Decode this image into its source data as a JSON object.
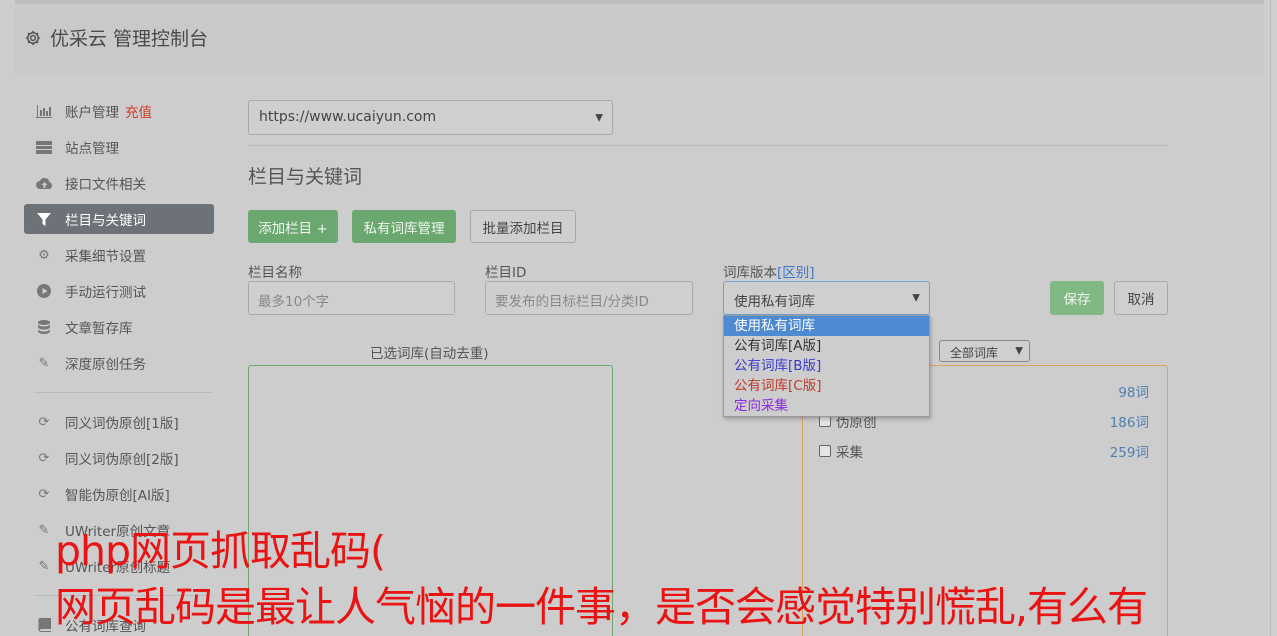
{
  "app": {
    "title": "优采云 管理控制台"
  },
  "sidebar": {
    "items": [
      {
        "label": "账户管理",
        "extra": "充值",
        "icon": "bar-chart-icon"
      },
      {
        "label": "站点管理",
        "icon": "server-icon"
      },
      {
        "label": "接口文件相关",
        "icon": "cloud-upload-icon"
      },
      {
        "label": "栏目与关键词",
        "icon": "filter-icon",
        "active": true
      },
      {
        "label": "采集细节设置",
        "icon": "cogs-icon"
      },
      {
        "label": "手动运行测试",
        "icon": "play-circle-icon"
      },
      {
        "label": "文章暂存库",
        "icon": "database-icon"
      },
      {
        "label": "深度原创任务",
        "icon": "edit-icon"
      }
    ],
    "items2": [
      {
        "label": "同义词伪原创[1版]",
        "icon": "refresh-icon"
      },
      {
        "label": "同义词伪原创[2版]",
        "icon": "refresh-icon"
      },
      {
        "label": "智能伪原创[AI版]",
        "icon": "refresh-icon"
      },
      {
        "label": "UWriter原创文章",
        "icon": "edit-icon"
      },
      {
        "label": "UWriter原创标题",
        "icon": "edit-icon"
      }
    ],
    "items3": [
      {
        "label": "公有词库查询",
        "icon": "book-icon"
      }
    ]
  },
  "main": {
    "site_select": "https://www.ucaiyun.com",
    "section_title": "栏目与关键词",
    "buttons": {
      "add_column": "添加栏目 +",
      "private_lib": "私有词库管理",
      "batch_add": "批量添加栏目",
      "save": "保存",
      "cancel": "取消"
    },
    "fields": {
      "name_label": "栏目名称",
      "name_placeholder": "最多10个字",
      "id_label": "栏目ID",
      "id_placeholder": "要发布的目标栏目/分类ID",
      "version_label": "词库版本",
      "version_link": "[区别]",
      "version_value": "使用私有词库"
    },
    "dropdown_options": [
      {
        "label": "使用私有词库",
        "selected": true,
        "color": "#ffffff"
      },
      {
        "label": "公有词库[A版]",
        "color": "#333333"
      },
      {
        "label": "公有词库[B版]",
        "color": "#3a3ad0"
      },
      {
        "label": "公有词库[C版]",
        "color": "#c0392b"
      },
      {
        "label": "定向采集",
        "color": "#8a2be2"
      }
    ],
    "selected_lib_label": "已选词库(自动去重)",
    "lib_filter": "全部词库",
    "libraries": [
      {
        "name": "",
        "count": "98词"
      },
      {
        "name": "伪原创",
        "count": "186词"
      },
      {
        "name": "采集",
        "count": "259词"
      }
    ]
  },
  "overlay": {
    "line1": "php网页抓取乱码(",
    "line2": "网页乱码是最让人气恼的一件事，是否会感觉特别慌乱,有么有"
  }
}
